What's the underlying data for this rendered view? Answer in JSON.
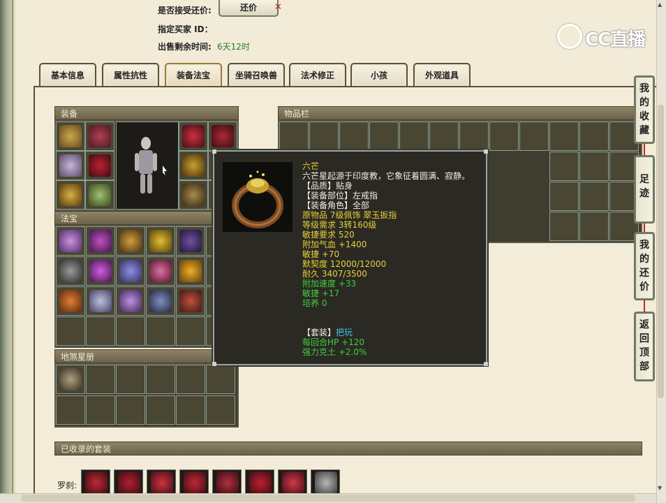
{
  "header": {
    "accept_counter_label": "是否接受还价:",
    "counter_button": "还价",
    "buyer_id_label": "指定买家 ID：",
    "remaining_label": "出售剩余时间:",
    "remaining_value": "6天12时"
  },
  "watermark": {
    "text": "CC直播"
  },
  "tabs": [
    {
      "label": "基本信息"
    },
    {
      "label": "属性抗性"
    },
    {
      "label": "装备法宝"
    },
    {
      "label": "坐骑召唤兽"
    },
    {
      "label": "法术修正"
    },
    {
      "label": "小孩"
    },
    {
      "label": "外观道具"
    }
  ],
  "active_tab_index": 2,
  "panels": {
    "equipment": "装备",
    "fabao": "法宝",
    "disha": "地煞星册",
    "inventory": "物品栏",
    "collected_sets": "已收录的套装"
  },
  "sets_row_label": "罗刹:",
  "side_buttons": [
    {
      "label": "我的收藏"
    },
    {
      "label": "足迹"
    },
    {
      "label": "我的还价"
    },
    {
      "label": "返回顶部"
    }
  ],
  "tooltip": {
    "name": "六芒",
    "description": "六芒星起源于印度教，它象征着圆满、寂静。",
    "quality": "【品质】贴身",
    "slot": "【装备部位】左戒指",
    "role": "【装备角色】全部",
    "origin": "原物品 7级佩饰 翠玉扳指",
    "level_req": "等级需求 3转160级",
    "agility_req": "敏捷要求 520",
    "add_hp": "附加气血 +1400",
    "agility": "敏捷 +70",
    "tacit": "默契度 12000/12000",
    "durability": "耐久 3407/3500",
    "add_speed": "附加速度 +33",
    "agility2": "敏捷 +17",
    "cultivate": "培养 0",
    "set_label": "【套装】",
    "set_name": "把玩",
    "set_effect1": "每回合HP +120",
    "set_effect2": "强力克土 +2.0%"
  },
  "colors": {
    "tooltip_yellow": "#e5d03b",
    "tooltip_green": "#3fce3f",
    "tooltip_cyan": "#44c6e8",
    "panel_header": "#7b7256"
  }
}
